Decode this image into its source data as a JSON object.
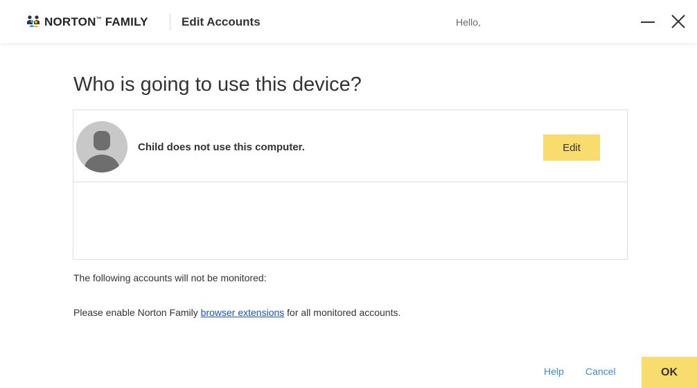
{
  "header": {
    "brand_name": "NORTON",
    "brand_tm": "™",
    "brand_suffix": " FAMILY",
    "section_title": "Edit Accounts",
    "greeting": "Hello,",
    "logo_icon": "family-people-icon",
    "minimize_icon": "minimize-icon",
    "close_icon": "close-icon"
  },
  "main": {
    "heading": "Who is going to use this device?",
    "accounts": [
      {
        "avatar_icon": "default-user-avatar-icon",
        "name": "Child does not use this computer.",
        "edit_label": "Edit"
      }
    ],
    "not_monitored_text": "The following accounts will not be monitored:",
    "enable_prefix": "Please enable Norton Family ",
    "enable_link": "browser extensions",
    "enable_suffix": " for all monitored accounts."
  },
  "footer": {
    "help_label": "Help",
    "cancel_label": "Cancel",
    "ok_label": "OK"
  },
  "colors": {
    "accent_yellow": "#f9dc6e",
    "link_blue": "#1a4fd1",
    "footer_link_blue": "#3b8ad8"
  }
}
